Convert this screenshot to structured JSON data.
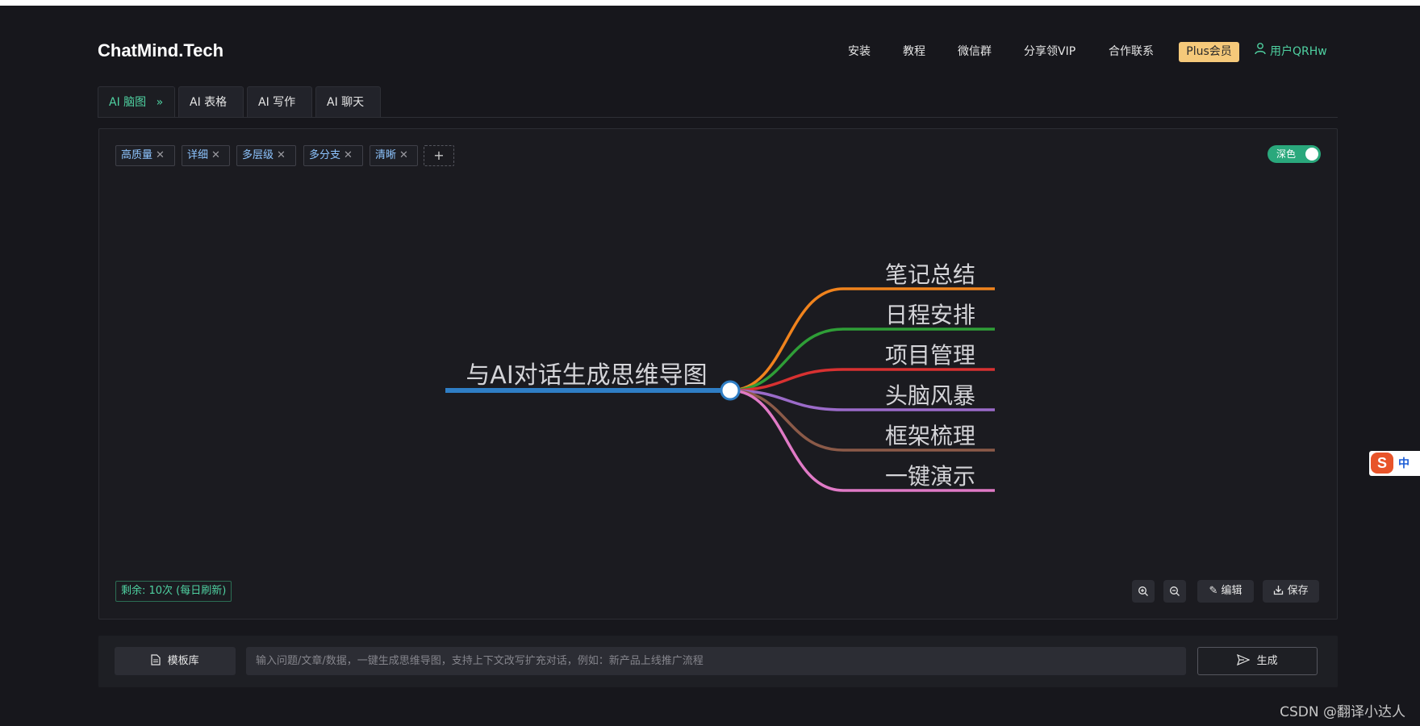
{
  "app": {
    "logo": "ChatMind.Tech"
  },
  "nav": {
    "items": [
      "安装",
      "教程",
      "微信群",
      "分享领VIP",
      "合作联系"
    ],
    "plus": "Plus会员",
    "user": "用户QRHw"
  },
  "tabs": [
    {
      "label": "AI 脑图",
      "suffix": "»",
      "active": true
    },
    {
      "label": "AI 表格",
      "active": false
    },
    {
      "label": "AI 写作",
      "active": false
    },
    {
      "label": "AI 聊天",
      "active": false
    }
  ],
  "tags": [
    "高质量",
    "详细",
    "多层级",
    "多分支",
    "清晰"
  ],
  "theme_toggle": {
    "label": "深色",
    "on": true
  },
  "mindmap": {
    "root": {
      "label": "与AI对话生成思维导图",
      "color": "#2f7ec5"
    },
    "branches": [
      {
        "label": "笔记总结",
        "color": "#f0831d"
      },
      {
        "label": "日程安排",
        "color": "#2f9e37"
      },
      {
        "label": "项目管理",
        "color": "#d83131"
      },
      {
        "label": "头脑风暴",
        "color": "#9b6bc9"
      },
      {
        "label": "框架梳理",
        "color": "#8b5a48"
      },
      {
        "label": "一键演示",
        "color": "#e07ac6"
      }
    ]
  },
  "remaining": "剩余: 10次 (每日刷新)",
  "toolbar": {
    "zoom_in": "zoom-in-icon",
    "zoom_out": "zoom-out-icon",
    "edit": "编辑",
    "save": "保存"
  },
  "bottom": {
    "template_label": "模板库",
    "input_placeholder": "输入问题/文章/数据，一键生成思维导图，支持上下文改写扩充对话，例如：新产品上线推广流程",
    "generate_label": "生成"
  },
  "ime": {
    "logo": "S",
    "mode": "中"
  },
  "watermark": "CSDN @翻译小达人",
  "colors": {
    "accent": "#4fd1a1",
    "plus": "#f5c97a",
    "background": "#17171c"
  }
}
